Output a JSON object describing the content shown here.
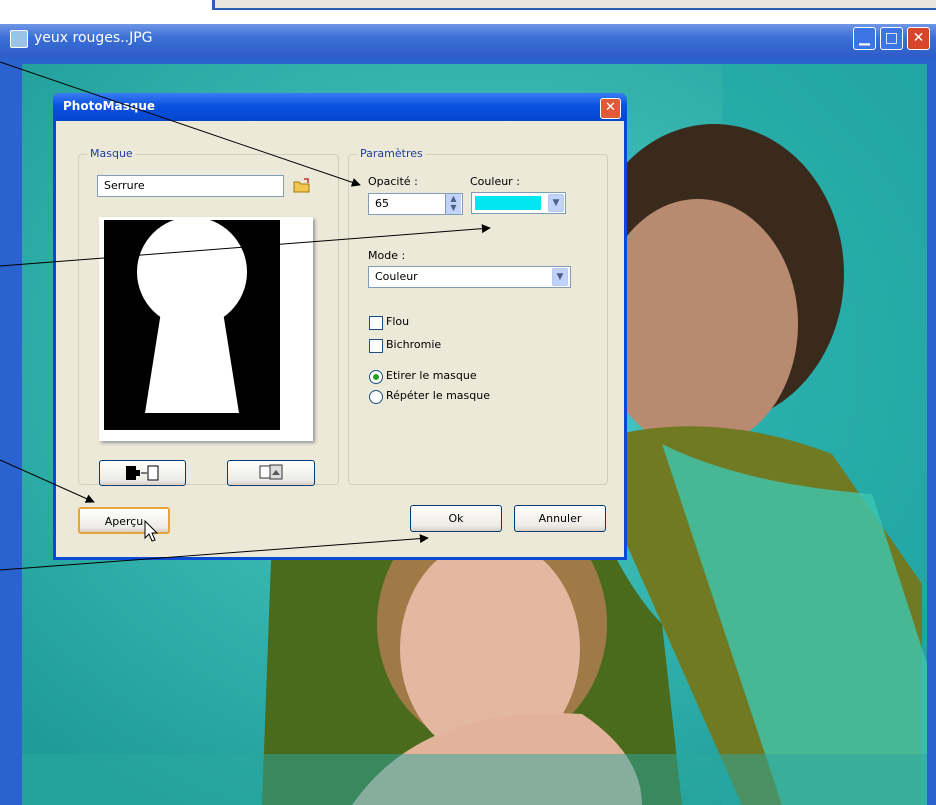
{
  "window": {
    "title": "yeux rouges..JPG",
    "min_label": "▁",
    "max_label": "□",
    "close_label": "✕"
  },
  "dialog": {
    "title": "PhotoMasque",
    "close_label": "✕",
    "mask_group": {
      "label": "Masque",
      "mask_name": "Serrure",
      "shape": "keyhole"
    },
    "params_group": {
      "label": "Paramètres",
      "opacity_label": "Opacité :",
      "opacity_value": "65",
      "color_label": "Couleur :",
      "color_value": "#00e6f0",
      "mode_label": "Mode :",
      "mode_value": "Couleur",
      "blur_label": "Flou",
      "blur_checked": false,
      "bichromie_label": "Bichromie",
      "bichromie_checked": false,
      "radio_stretch_label": "Etirer le masque",
      "radio_repeat_label": "Répéter le masque",
      "selected_radio": "stretch"
    },
    "buttons": {
      "preview": "Aperçu",
      "ok": "Ok",
      "cancel": "Annuler"
    },
    "icons": {
      "invert": "invert-mask-icon",
      "image": "load-image-icon",
      "folder": "open-folder-icon"
    }
  },
  "colors": {
    "canvas_tint": "#2fb8b0",
    "xp_blue": "#0a48d8",
    "dialog_bg": "#ece9d8"
  }
}
